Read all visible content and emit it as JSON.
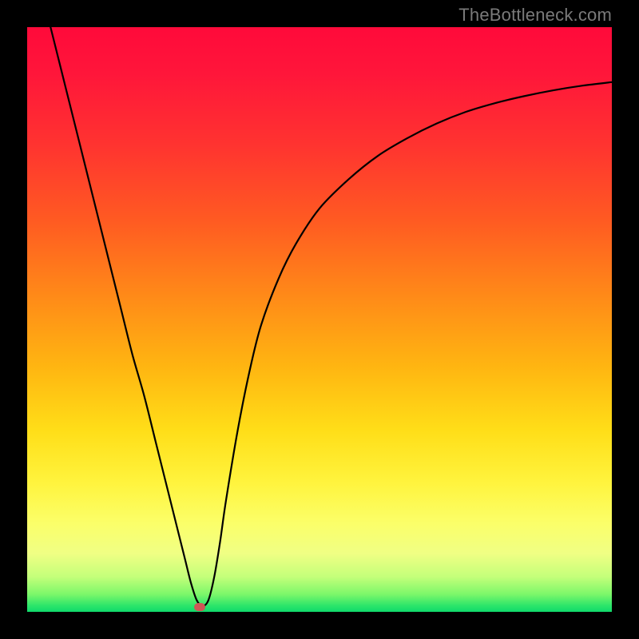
{
  "watermark": "TheBottleneck.com",
  "chart_data": {
    "type": "line",
    "title": "",
    "xlabel": "",
    "ylabel": "",
    "xlim": [
      0,
      100
    ],
    "ylim": [
      0,
      100
    ],
    "x": [
      4,
      6,
      8,
      10,
      12,
      14,
      16,
      18,
      20,
      22,
      24,
      26,
      27,
      28,
      29,
      30,
      31,
      32,
      33,
      34,
      36,
      38,
      40,
      43,
      46,
      50,
      55,
      60,
      65,
      70,
      75,
      80,
      85,
      90,
      95,
      100
    ],
    "y": [
      100,
      92,
      84,
      76,
      68,
      60,
      52,
      44,
      37,
      29,
      21,
      13,
      9,
      5,
      2,
      1,
      2,
      6,
      12,
      19,
      31,
      41,
      49,
      57,
      63,
      69,
      74,
      78,
      81,
      83.5,
      85.5,
      87,
      88.2,
      89.2,
      90,
      90.6
    ],
    "marker": {
      "x": 29.5,
      "y": 0.8
    }
  },
  "colors": {
    "curve": "#000000",
    "marker": "#cf5656",
    "frame": "#000000"
  }
}
